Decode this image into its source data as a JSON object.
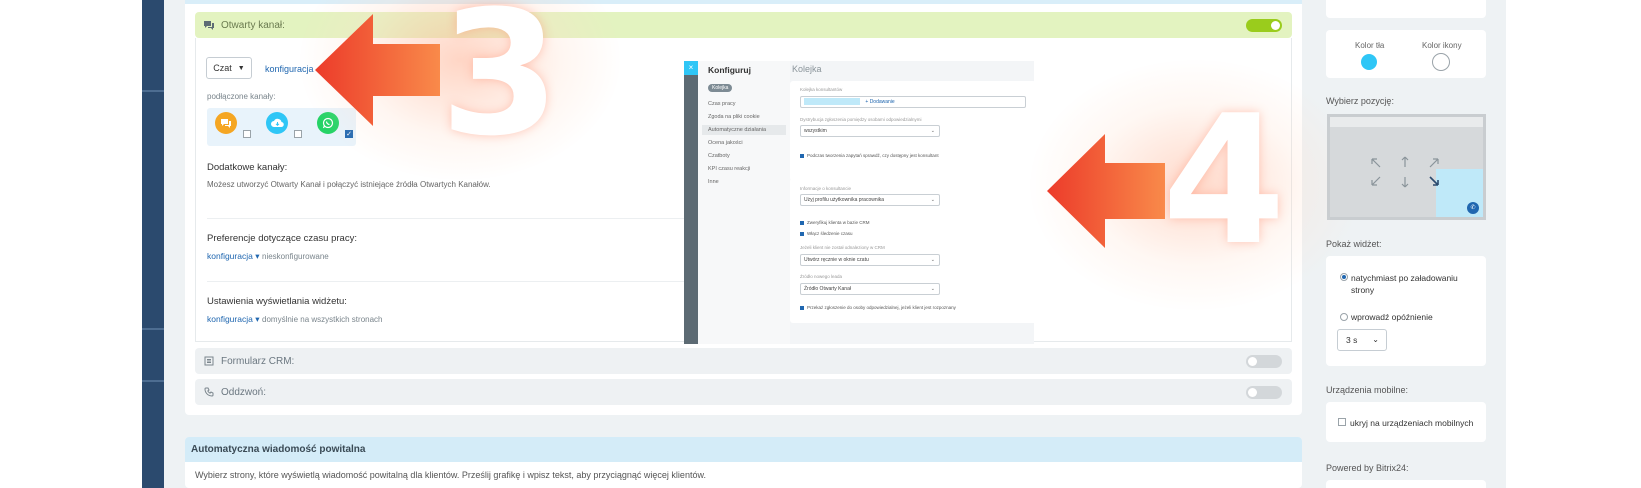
{
  "open_channel": {
    "title": "Otwarty kanał:",
    "toggle_on": true,
    "selector_value": "Czat",
    "config_link": "konfiguracja",
    "connected_label": "podłączone kanały:",
    "channels": [
      {
        "icon": "chat-bubble-icon",
        "color": "#f5a623",
        "checked": false
      },
      {
        "icon": "cloud-download-icon",
        "color": "#2fc6f6",
        "checked": false
      },
      {
        "icon": "whatsapp-icon",
        "color": "#25d366",
        "checked": true
      }
    ],
    "extra_title": "Dodatkowe kanały:",
    "extra_desc": "Możesz utworzyć Otwarty Kanał i połączyć istniejące źródła Otwartych Kanałów.",
    "hours_title": "Preferencje dotyczące czasu pracy:",
    "hours_link": "konfiguracja",
    "hours_value": "nieskonfigurowane",
    "display_title": "Ustawienia wyświetlania widżetu:",
    "display_link": "konfiguracja",
    "display_value": "domyślnie na wszystkich stronach"
  },
  "inset": {
    "menu_title": "Konfiguruj",
    "active_badge": "Kolejka",
    "menu_items": [
      "Czas pracy",
      "Zgoda na pliki cookie",
      "Automatyczne działania",
      "Ocena jakości",
      "Czatboty",
      "KPI czasu reakcji",
      "Inne"
    ],
    "header": "Kolejka",
    "queue_label": "Kolejka konsultantów",
    "queue_add": "+ Dodawanie",
    "distribution_label": "Dystrybucja zgłoszenia pomiędzy osobami odpowiedzialnymi",
    "distribution_value": "wszystkim",
    "check1": "Podczas tworzenia zapytań sprawdź, czy dostępny jest konsultant",
    "info_label": "Informacje o konsultancie",
    "info_value": "Użyj profilu użytkownika pracownika",
    "check2": "Zweryfikuj klienta w bazie CRM",
    "check3": "Włącz śledzenie czasu",
    "crm_label": "Jeżeli klient nie został odnaleziony w CRM",
    "crm_value": "Utwórz ręcznie w oknie czatu",
    "source_label": "Źródło nowego leada",
    "source_value": "Źródło Otwarty Kanał",
    "check4": "Przekaż zgłoszenie do osoby odpowiedzialnej, jeżeli klient jest rozpoznany"
  },
  "annotations": {
    "num_3": "3",
    "num_4": "4"
  },
  "crm_form": {
    "title": "Formularz CRM:",
    "toggle_on": false
  },
  "callback": {
    "title": "Oddzwoń:",
    "toggle_on": false
  },
  "auto_message": {
    "title": "Automatyczna wiadomość powitalna",
    "desc": "Wybierz strony, które wyświetlą wiadomość powitalną dla klientów. Prześlij grafikę i wpisz tekst, aby przyciągnąć więcej klientów."
  },
  "sidebar": {
    "bg_color_label": "Kolor tła",
    "icon_color_label": "Kolor ikony",
    "bg_color": "#2fc6f6",
    "icon_color": "#ffffff",
    "position_label": "Wybierz pozycję:",
    "show_widget_label": "Pokaż widżet:",
    "show_immediate": "natychmiast po załadowaniu strony",
    "show_delay": "wprowadź opóźnienie",
    "delay_value": "3 s",
    "mobile_label": "Urządzenia mobilne:",
    "mobile_hide": "ukryj na urządzeniach mobilnych",
    "powered_label": "Powered by Bitrix24:"
  }
}
